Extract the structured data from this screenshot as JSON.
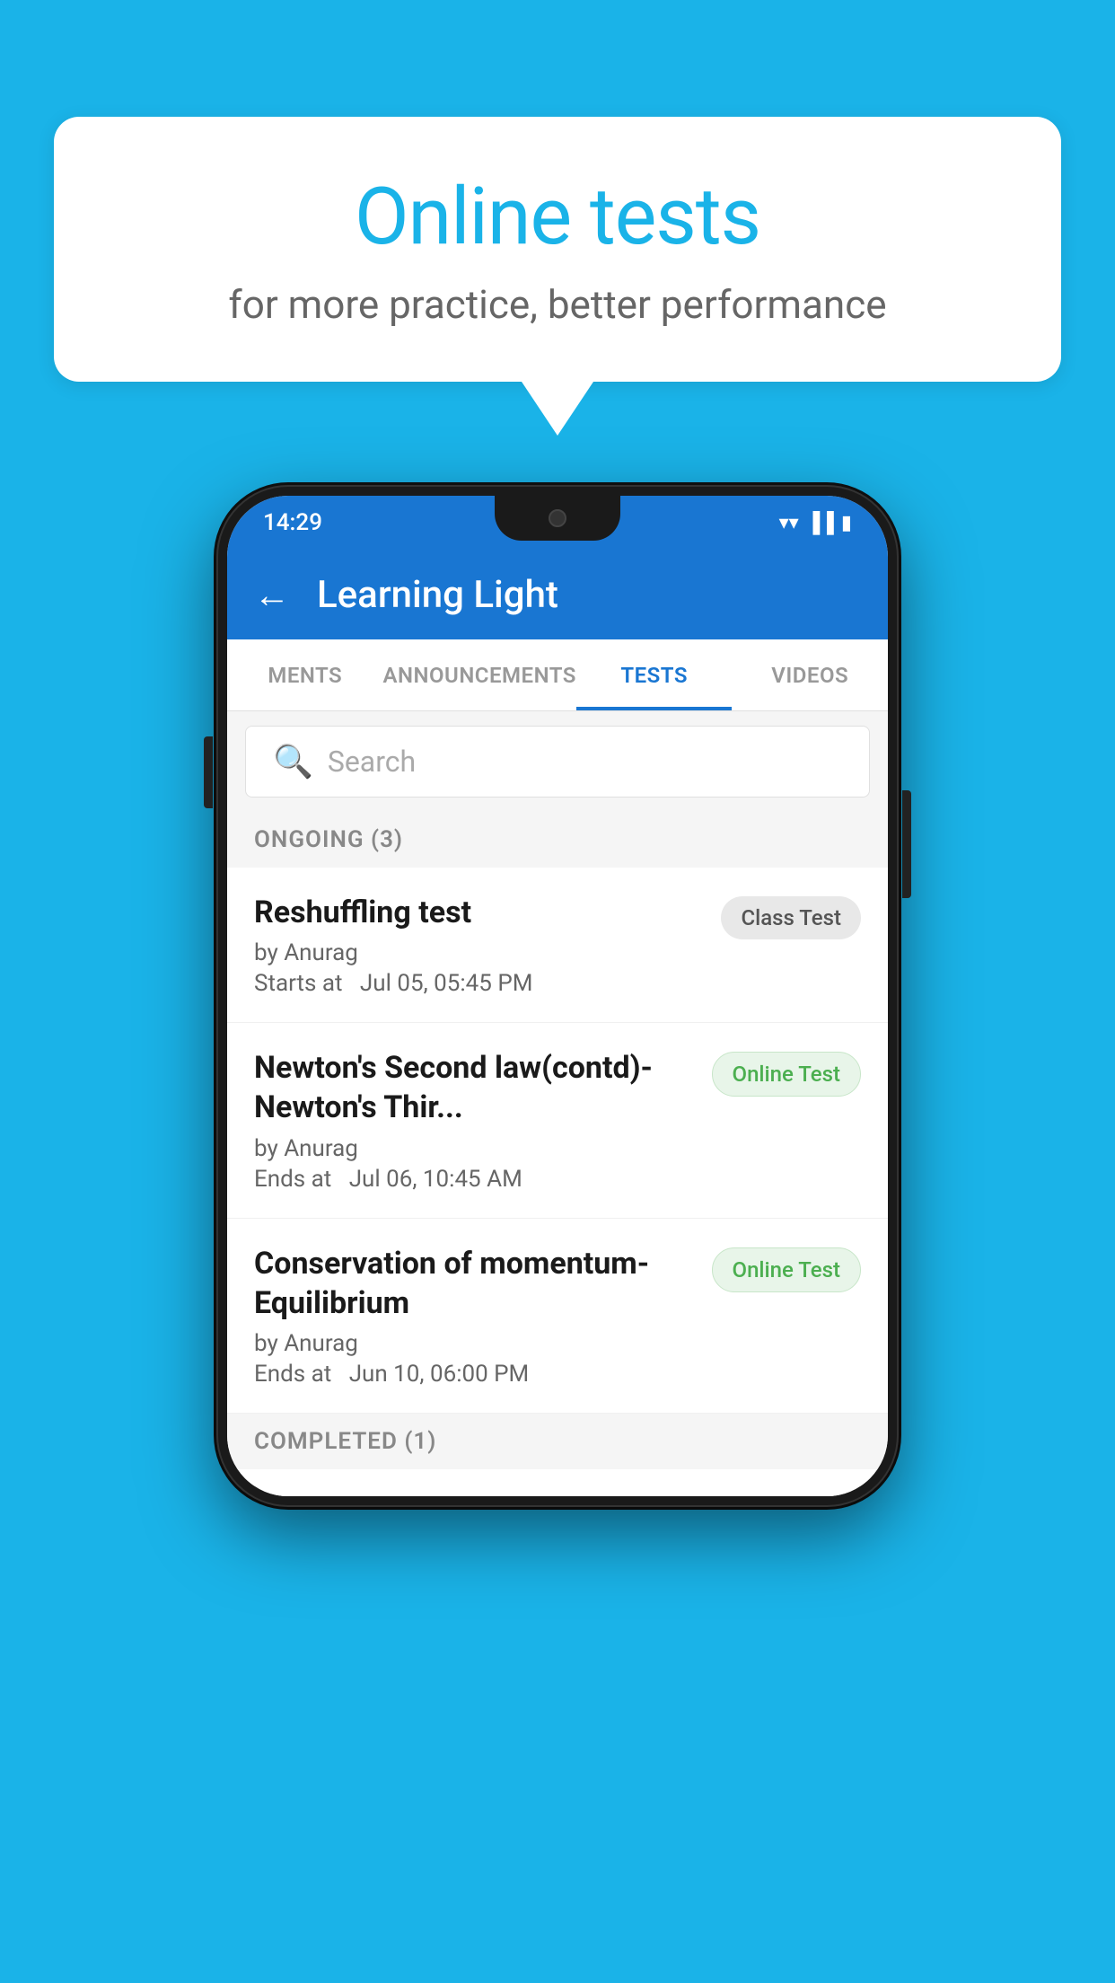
{
  "background_color": "#1ab3e8",
  "speech_bubble": {
    "title": "Online tests",
    "subtitle": "for more practice, better performance"
  },
  "phone": {
    "status_bar": {
      "time": "14:29",
      "wifi_icon": "▼",
      "signal_icon": "◀",
      "battery_icon": "▮"
    },
    "app_bar": {
      "back_label": "←",
      "title": "Learning Light"
    },
    "tabs": [
      {
        "label": "MENTS",
        "active": false
      },
      {
        "label": "ANNOUNCEMENTS",
        "active": false
      },
      {
        "label": "TESTS",
        "active": true
      },
      {
        "label": "VIDEOS",
        "active": false
      }
    ],
    "search": {
      "placeholder": "Search"
    },
    "ongoing_section": {
      "header": "ONGOING (3)",
      "items": [
        {
          "title": "Reshuffling test",
          "author": "by Anurag",
          "time_label": "Starts at",
          "time_value": "Jul 05, 05:45 PM",
          "badge": "Class Test",
          "badge_type": "class"
        },
        {
          "title": "Newton's Second law(contd)-Newton's Thir...",
          "author": "by Anurag",
          "time_label": "Ends at",
          "time_value": "Jul 06, 10:45 AM",
          "badge": "Online Test",
          "badge_type": "online"
        },
        {
          "title": "Conservation of momentum-Equilibrium",
          "author": "by Anurag",
          "time_label": "Ends at",
          "time_value": "Jun 10, 06:00 PM",
          "badge": "Online Test",
          "badge_type": "online"
        }
      ]
    },
    "completed_section": {
      "header": "COMPLETED (1)"
    }
  }
}
